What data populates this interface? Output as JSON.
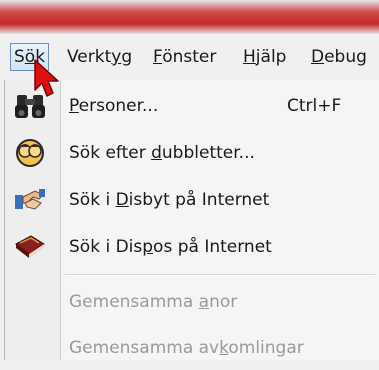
{
  "menubar": {
    "items": [
      {
        "pre": "S",
        "u": "ö",
        "post": "k"
      },
      {
        "pre": "Verkt",
        "u": "y",
        "post": "g"
      },
      {
        "pre": "",
        "u": "F",
        "post": "önster"
      },
      {
        "pre": "",
        "u": "H",
        "post": "jälp"
      },
      {
        "pre": "",
        "u": "D",
        "post": "ebug"
      }
    ]
  },
  "menu": {
    "personer": {
      "pre": "",
      "u": "P",
      "post": "ersoner...",
      "shortcut": "Ctrl+F",
      "icon": "binoculars-icon"
    },
    "dubbletter": {
      "pre": "Sök efter ",
      "u": "d",
      "post": "ubbletter...",
      "icon": "twins-icon"
    },
    "disbyt": {
      "pre": "Sök i ",
      "u": "D",
      "post": "isbyt på Internet",
      "icon": "handshake-icon"
    },
    "dispos": {
      "pre": "Sök i Dis",
      "u": "p",
      "post": "os på Internet",
      "icon": "book-icon"
    },
    "anor": {
      "pre": "Gemensamma ",
      "u": "a",
      "post": "nor"
    },
    "avkomlingar": {
      "pre": "Gemensamma av",
      "u": "k",
      "post": "omlingar"
    }
  }
}
